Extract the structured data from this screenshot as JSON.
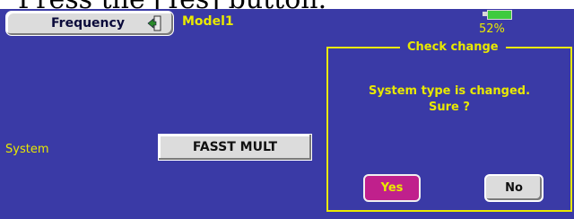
{
  "caption": "Press the [Yes] button.",
  "header": {
    "tab_label": "Frequency",
    "model_name": "Model1",
    "battery_percent": "52%",
    "battery_level": 0.52
  },
  "system": {
    "label": "System",
    "value": "FASST MULT"
  },
  "dialog": {
    "title": "Check change",
    "message_line1": "System type is changed.",
    "message_line2": "Sure ?",
    "yes_label": "Yes",
    "no_label": "No"
  },
  "colors": {
    "screen_bg": "#3a3aa6",
    "accent_yellow": "#e9e900",
    "yes_button": "#c0208c",
    "battery_fill": "#3ecb3e"
  },
  "icons": {
    "back": "back-arrow-icon",
    "battery": "battery-icon"
  }
}
